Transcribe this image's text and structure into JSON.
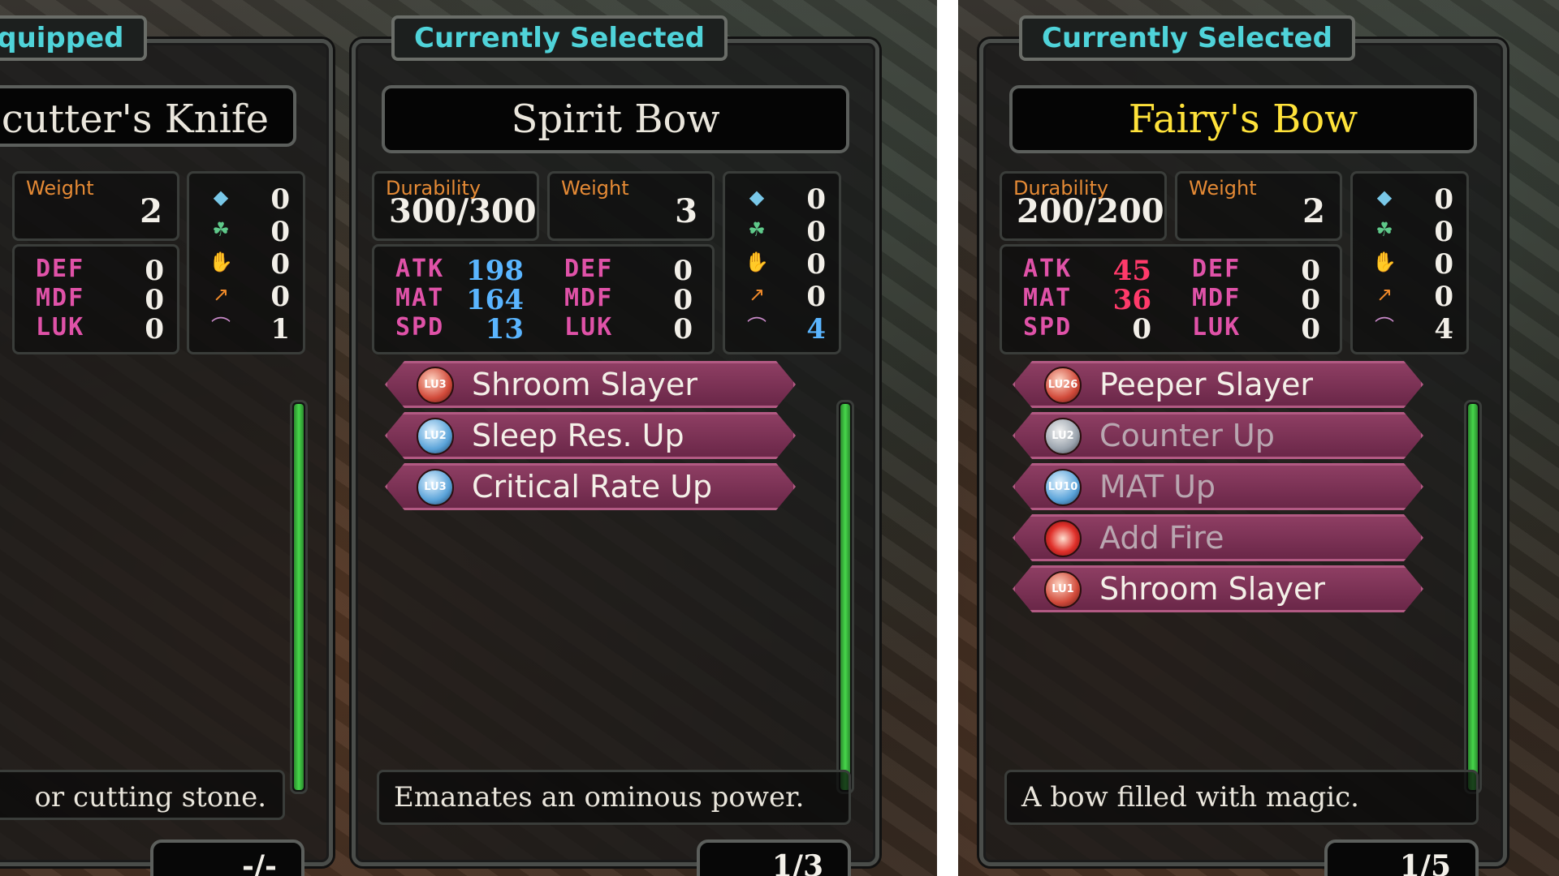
{
  "left_screenshot": {
    "equipped_panel": {
      "tab": "Equipped",
      "name": "cutter's Knife",
      "weight_label": "Weight",
      "weight": "2",
      "stats": [
        {
          "name": "DEF",
          "value": "0"
        },
        {
          "name": "MDF",
          "value": "0"
        },
        {
          "name": "LUK",
          "value": "0"
        }
      ],
      "elements": [
        {
          "icon": "water-drop-icon",
          "value": "0"
        },
        {
          "icon": "leaf-icon",
          "value": "0"
        },
        {
          "icon": "hand-icon",
          "value": "0"
        },
        {
          "icon": "fire-arrow-icon",
          "value": "0"
        },
        {
          "icon": "sickle-icon",
          "value": "1"
        }
      ],
      "description": "or cutting stone.",
      "pager": "-/-",
      "bar_fill_fraction": 1.0
    },
    "selected_panel": {
      "tab": "Currently Selected",
      "name": "Spirit Bow",
      "durability_label": "Durability",
      "durability": "300/300",
      "weight_label": "Weight",
      "weight": "3",
      "left_stats": [
        {
          "name": "ATK",
          "value": "198"
        },
        {
          "name": "MAT",
          "value": "164"
        },
        {
          "name": "SPD",
          "value": "13"
        }
      ],
      "right_stats": [
        {
          "name": "DEF",
          "value": "0"
        },
        {
          "name": "MDF",
          "value": "0"
        },
        {
          "name": "LUK",
          "value": "0"
        }
      ],
      "elements": [
        {
          "icon": "water-drop-icon",
          "value": "0"
        },
        {
          "icon": "leaf-icon",
          "value": "0"
        },
        {
          "icon": "hand-icon",
          "value": "0"
        },
        {
          "icon": "fire-arrow-icon",
          "value": "0"
        },
        {
          "icon": "sickle-icon",
          "value": "4"
        }
      ],
      "skills": [
        {
          "level": "LU3",
          "name": "Shroom Slayer",
          "icon": "slayer-icon"
        },
        {
          "level": "LU2",
          "name": "Sleep Res. Up",
          "icon": "sleep-icon"
        },
        {
          "level": "LU3",
          "name": "Critical Rate Up",
          "icon": "critical-icon"
        }
      ],
      "description": "Emanates an ominous power.",
      "pager": "1/3",
      "bar_fill_fraction": 1.0
    }
  },
  "right_screenshot": {
    "selected_panel": {
      "tab": "Currently Selected",
      "name": "Fairy's Bow",
      "name_color": "#ffe23a",
      "durability_label": "Durability",
      "durability": "200/200",
      "weight_label": "Weight",
      "weight": "2",
      "left_stats": [
        {
          "name": "ATK",
          "value": "45"
        },
        {
          "name": "MAT",
          "value": "36"
        },
        {
          "name": "SPD",
          "value": "0"
        }
      ],
      "right_stats": [
        {
          "name": "DEF",
          "value": "0"
        },
        {
          "name": "MDF",
          "value": "0"
        },
        {
          "name": "LUK",
          "value": "0"
        }
      ],
      "elements": [
        {
          "icon": "water-drop-icon",
          "value": "0"
        },
        {
          "icon": "leaf-icon",
          "value": "0"
        },
        {
          "icon": "hand-icon",
          "value": "0"
        },
        {
          "icon": "fire-arrow-icon",
          "value": "0"
        },
        {
          "icon": "sickle-icon",
          "value": "4"
        }
      ],
      "skills": [
        {
          "level": "LU26",
          "name": "Peeper Slayer",
          "icon": "slayer-icon"
        },
        {
          "level": "LU2",
          "name": "Counter Up",
          "icon": "counter-icon"
        },
        {
          "level": "LU10",
          "name": "MAT Up",
          "icon": "mat-icon"
        },
        {
          "level": "",
          "name": "Add Fire",
          "icon": "fire-icon"
        },
        {
          "level": "LU1",
          "name": "Shroom Slayer",
          "icon": "slayer-icon"
        }
      ],
      "description": "A bow filled with magic.",
      "pager": "1/5",
      "bar_fill_fraction": 1.0
    }
  },
  "colors": {
    "tab_text": "#4fd3d9",
    "label": "#e58a35",
    "stat_name": "#e052a8",
    "stat_up": "#5ab5ff",
    "stat_down": "#ff3a6a",
    "skill_bg": "#7a3054",
    "bar": "#46d64a"
  }
}
